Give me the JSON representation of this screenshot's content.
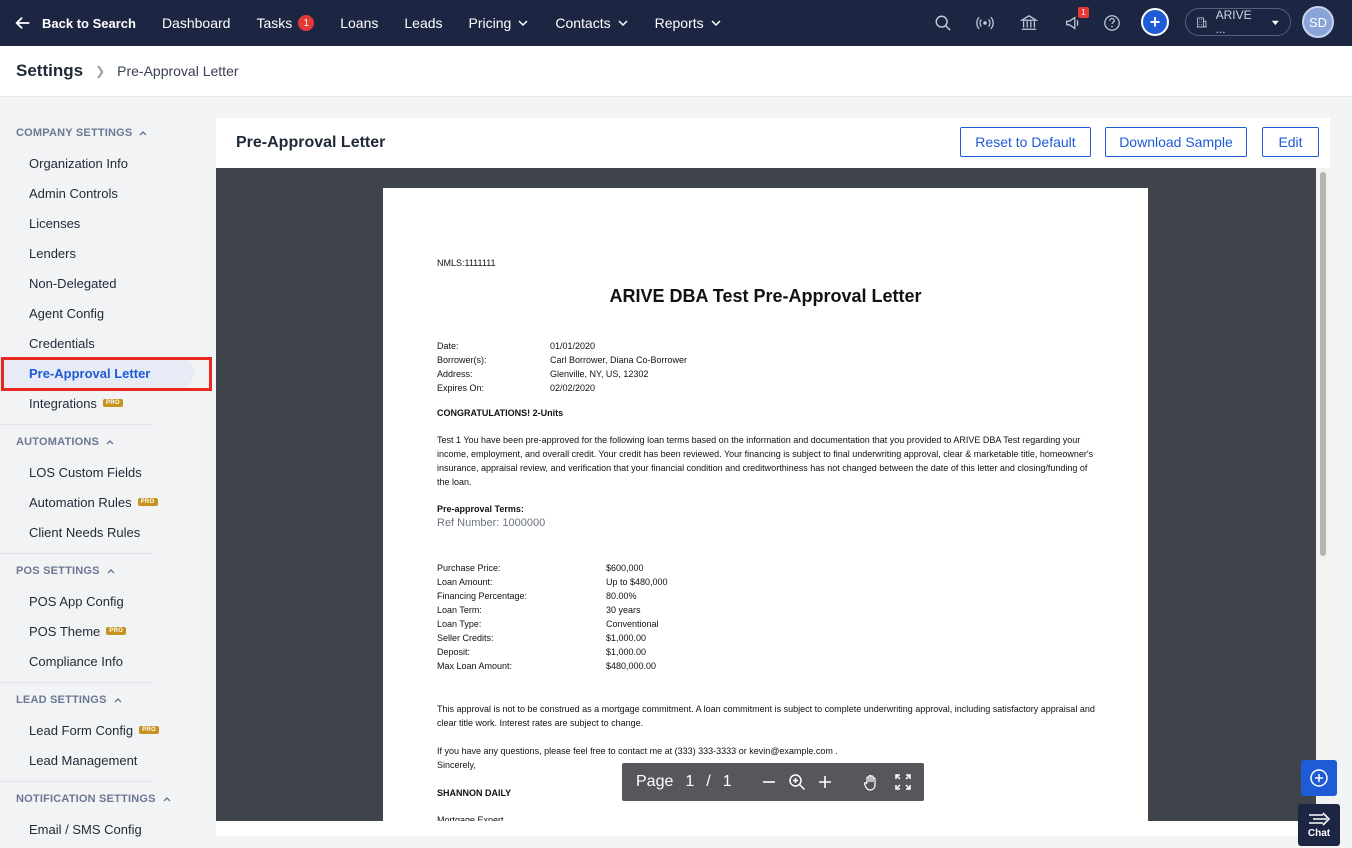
{
  "topnav": {
    "back_label": "Back to Search",
    "items": [
      {
        "label": "Dashboard"
      },
      {
        "label": "Tasks",
        "badge": "1"
      },
      {
        "label": "Loans"
      },
      {
        "label": "Leads"
      },
      {
        "label": "Pricing"
      },
      {
        "label": "Contacts"
      },
      {
        "label": "Reports"
      }
    ],
    "notification_badge": "1",
    "company_label": "ARIVE ...",
    "avatar_initials": "SD"
  },
  "breadcrumb": {
    "title": "Settings",
    "current": "Pre-Approval Letter"
  },
  "sidebar": {
    "company_settings": {
      "header": "COMPANY SETTINGS",
      "items": [
        "Organization Info",
        "Admin Controls",
        "Licenses",
        "Lenders",
        "Non-Delegated",
        "Agent Config",
        "Credentials",
        "Pre-Approval Letter",
        "Integrations"
      ]
    },
    "automations": {
      "header": "AUTOMATIONS",
      "items": [
        "LOS Custom Fields",
        "Automation Rules",
        "Client Needs Rules"
      ]
    },
    "pos_settings": {
      "header": "POS SETTINGS",
      "items": [
        "POS App Config",
        "POS Theme",
        "Compliance Info"
      ]
    },
    "lead_settings": {
      "header": "LEAD SETTINGS",
      "items": [
        "Lead Form Config",
        "Lead Management"
      ]
    },
    "notification_settings": {
      "header": "NOTIFICATION SETTINGS",
      "items": [
        "Email / SMS Config"
      ]
    },
    "pro_label": "PRO"
  },
  "panel": {
    "title": "Pre-Approval Letter",
    "reset_label": "Reset to Default",
    "download_label": "Download Sample",
    "edit_label": "Edit"
  },
  "letter": {
    "nmls": "NMLS:1111111",
    "title": "ARIVE DBA Test    Pre-Approval Letter",
    "header_fields": [
      {
        "k": "Date:",
        "v": "01/01/2020"
      },
      {
        "k": "Borrower(s):",
        "v": "Carl Borrower, Diana Co-Borrower"
      },
      {
        "k": "Address:",
        "v": "Glenville, NY, US, 12302"
      },
      {
        "k": "Expires On:",
        "v": "02/02/2020"
      }
    ],
    "congrats": "CONGRATULATIONS! 2-Units",
    "body1": "Test 1 You have been pre-approved for the following loan terms based on the information and  documentation that you provided to ARIVE DBA Test    regarding your income, employment, and overall credit. Your credit has  been reviewed. Your financing is subject to final underwriting approval, clear & marketable title, homeowner's  insurance, appraisal review, and verification that your financial condition and creditworthiness has not changed  between the date of this letter and closing/funding of the loan.",
    "terms_heading": "Pre-approval Terms:",
    "ref_number": "Ref Number: 1000000",
    "terms": [
      {
        "k": "Purchase Price:",
        "v": "$600,000"
      },
      {
        "k": "Loan Amount:",
        "v": "Up to $480,000"
      },
      {
        "k": "Financing Percentage:",
        "v": "80.00%"
      },
      {
        "k": "Loan Term:",
        "v": "30 years"
      },
      {
        "k": "Loan Type:",
        "v": "Conventional"
      },
      {
        "k": "Seller Credits:",
        "v": "$1,000.00"
      },
      {
        "k": "Deposit:",
        "v": "$1,000.00"
      },
      {
        "k": "Max Loan Amount:",
        "v": "$480,000.00"
      }
    ],
    "body2": "This approval is not to be construed as a mortgage commitment. A loan commitment is subject to  complete underwriting approval, including satisfactory appraisal and clear title work. Interest rates are subject  to change.",
    "body3": "If you have any questions, please feel free to contact me at (333) 333-3333    or kevin@example.com    .",
    "sincerely": "Sincerely,",
    "signer": "SHANNON DAILY",
    "signer_title": "Mortgage Expert"
  },
  "pdf_toolbar": {
    "page_label": "Page",
    "current_page": "1",
    "separator": "/",
    "total_pages": "1"
  },
  "chat_label": "Chat"
}
